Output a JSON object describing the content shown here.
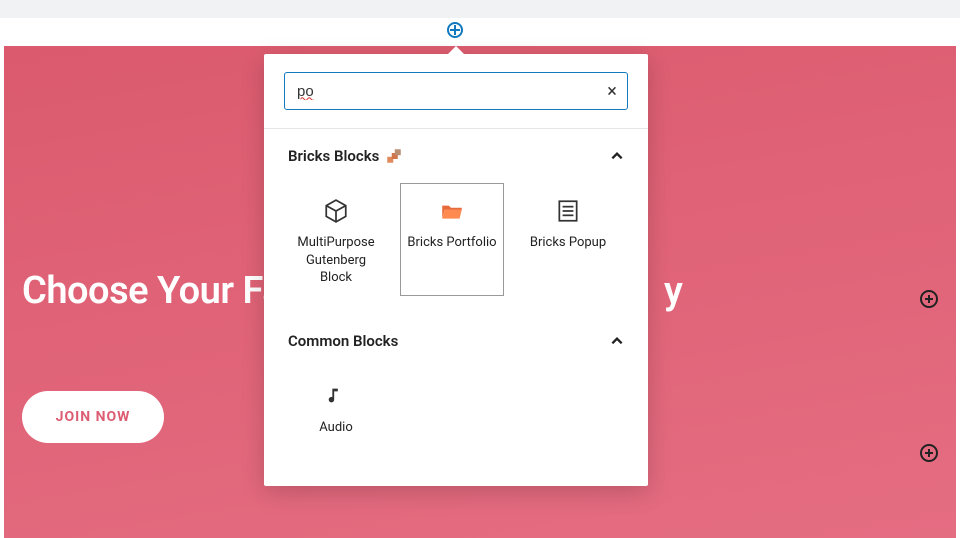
{
  "hero": {
    "title_partial": "Choose Your Fa",
    "title_trailing_char": "y",
    "cta_label": "JOIN NOW"
  },
  "inserter": {
    "search_value": "po",
    "clear_glyph": "×",
    "categories": [
      {
        "title": "Bricks Blocks",
        "expanded": true,
        "blocks": [
          {
            "name": "multipurpose-gutenberg-block",
            "label": "MultiPurpose Gutenberg Block"
          },
          {
            "name": "bricks-portfolio",
            "label": "Bricks Portfolio",
            "selected": true
          },
          {
            "name": "bricks-popup",
            "label": "Bricks Popup"
          }
        ]
      },
      {
        "title": "Common Blocks",
        "expanded": true,
        "blocks": [
          {
            "name": "audio",
            "label": "Audio"
          }
        ]
      }
    ]
  }
}
